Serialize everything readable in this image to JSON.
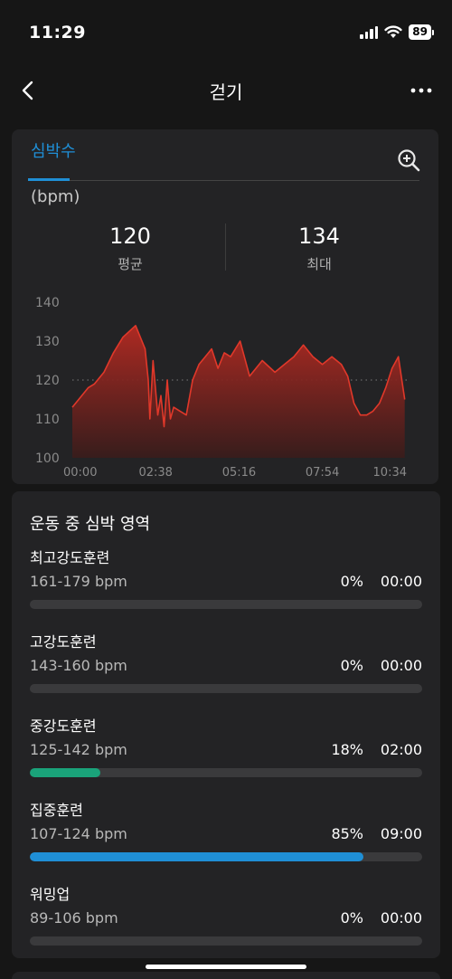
{
  "status": {
    "time": "11:29",
    "battery": "89"
  },
  "nav": {
    "title": "걷기"
  },
  "heart": {
    "tab": "심박수",
    "unit": "(bpm)",
    "avg_value": "120",
    "avg_label": "평균",
    "max_value": "134",
    "max_label": "최대"
  },
  "chart_data": {
    "type": "area",
    "ylim": [
      100,
      140
    ],
    "yticks": [
      "140",
      "130",
      "120",
      "110",
      "100"
    ],
    "xtick_labels": [
      "00:00",
      "02:38",
      "05:16",
      "07:54",
      "10:34"
    ],
    "reference_line": 120,
    "x_minutes": [
      0,
      0.3,
      0.5,
      0.7,
      1.0,
      1.3,
      1.6,
      2.0,
      2.3,
      2.4,
      2.45,
      2.55,
      2.7,
      2.8,
      2.9,
      3.0,
      3.1,
      3.2,
      3.4,
      3.6,
      3.8,
      4.0,
      4.2,
      4.4,
      4.6,
      4.8,
      5.0,
      5.3,
      5.6,
      6.0,
      6.4,
      6.7,
      7.0,
      7.3,
      7.6,
      7.9,
      8.2,
      8.5,
      8.7,
      8.9,
      9.1,
      9.3,
      9.5,
      9.7,
      9.9,
      10.1,
      10.3,
      10.5
    ],
    "bpm": [
      113,
      116,
      118,
      119,
      122,
      127,
      131,
      134,
      128,
      120,
      110,
      125,
      111,
      116,
      108,
      120,
      110,
      113,
      112,
      111,
      120,
      124,
      126,
      128,
      123,
      127,
      126,
      130,
      121,
      125,
      122,
      124,
      126,
      129,
      126,
      124,
      126,
      124,
      121,
      114,
      111,
      111,
      112,
      114,
      118,
      123,
      126,
      115
    ],
    "line_color": "#e0382a"
  },
  "zones": {
    "title": "운동 중 심박 영역",
    "items": [
      {
        "name": "최고강도훈련",
        "range": "161-179 bpm",
        "percent": "0%",
        "time": "00:00",
        "fill": 0,
        "color": "#1f8fd6"
      },
      {
        "name": "고강도훈련",
        "range": "143-160 bpm",
        "percent": "0%",
        "time": "00:00",
        "fill": 0,
        "color": "#1f8fd6"
      },
      {
        "name": "중강도훈련",
        "range": "125-142 bpm",
        "percent": "18%",
        "time": "02:00",
        "fill": 0.18,
        "color": "#1aa37a"
      },
      {
        "name": "집중훈련",
        "range": "107-124 bpm",
        "percent": "85%",
        "time": "09:00",
        "fill": 0.85,
        "color": "#1f8fd6"
      },
      {
        "name": "워밍업",
        "range": "89-106 bpm",
        "percent": "0%",
        "time": "00:00",
        "fill": 0,
        "color": "#1f8fd6"
      }
    ]
  }
}
